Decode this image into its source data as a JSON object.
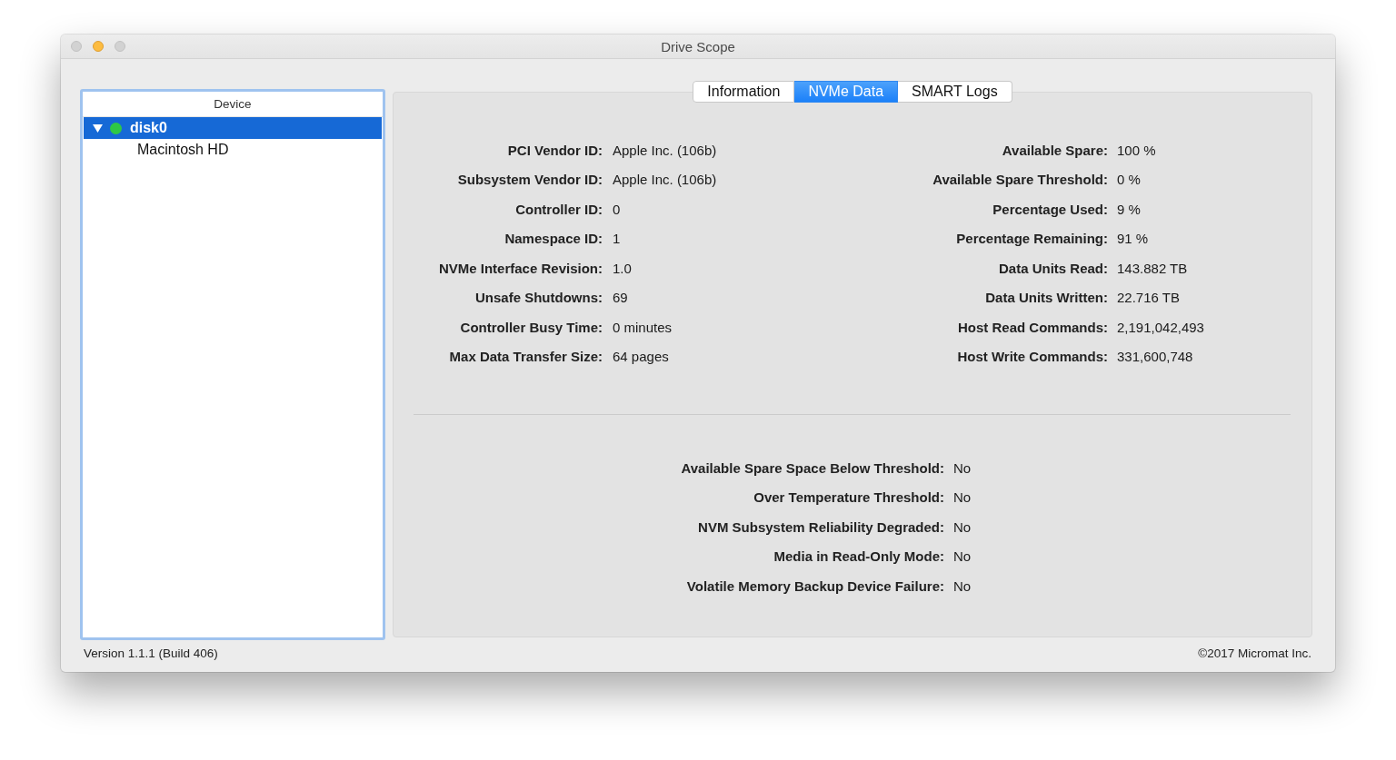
{
  "window": {
    "title": "Drive Scope",
    "window_buttons": [
      {
        "kind": "close",
        "enabled": false
      },
      {
        "kind": "minimize",
        "enabled": true
      },
      {
        "kind": "zoom",
        "enabled": false
      }
    ]
  },
  "sidebar": {
    "header": "Device",
    "items": [
      {
        "label": "disk0",
        "selected": true,
        "expanded": true,
        "color": "#2ec846",
        "children": [
          {
            "label": "Macintosh HD",
            "selected": false
          }
        ]
      }
    ]
  },
  "tabs": [
    {
      "label": "Information",
      "selected": false
    },
    {
      "label": "NVMe Data",
      "selected": true
    },
    {
      "label": "SMART Logs",
      "selected": false
    }
  ],
  "details_left": [
    {
      "label": "PCI Vendor ID:",
      "value": "Apple Inc. (106b)"
    },
    {
      "label": "Subsystem Vendor ID:",
      "value": "Apple Inc. (106b)"
    },
    {
      "label": "Controller ID:",
      "value": "0"
    },
    {
      "label": "Namespace ID:",
      "value": "1"
    },
    {
      "label": "NVMe Interface Revision:",
      "value": "1.0"
    },
    {
      "label": "Unsafe Shutdowns:",
      "value": "69"
    },
    {
      "label": "Controller Busy Time:",
      "value": "0 minutes"
    },
    {
      "label": "Max Data Transfer Size:",
      "value": "64 pages"
    }
  ],
  "details_right": [
    {
      "label": "Available Spare:",
      "value": "100 %"
    },
    {
      "label": "Available Spare Threshold:",
      "value": "0 %"
    },
    {
      "label": "Percentage Used:",
      "value": "9 %"
    },
    {
      "label": "Percentage Remaining:",
      "value": "91 %"
    },
    {
      "label": "Data Units Read:",
      "value": "143.882 TB"
    },
    {
      "label": "Data Units Written:",
      "value": "22.716 TB"
    },
    {
      "label": "Host Read Commands:",
      "value": "2,191,042,493"
    },
    {
      "label": "Host Write Commands:",
      "value": "331,600,748"
    }
  ],
  "warnings": [
    {
      "label": "Available Spare Space Below Threshold:",
      "value": "No"
    },
    {
      "label": "Over Temperature Threshold:",
      "value": "No"
    },
    {
      "label": "NVM Subsystem Reliability Degraded:",
      "value": "No"
    },
    {
      "label": "Media in Read-Only Mode:",
      "value": "No"
    },
    {
      "label": "Volatile Memory Backup Device Failure:",
      "value": "No"
    }
  ],
  "footer": {
    "version": "Version 1.1.1 (Build 406)",
    "copyright": "©2017 Micromat Inc."
  }
}
